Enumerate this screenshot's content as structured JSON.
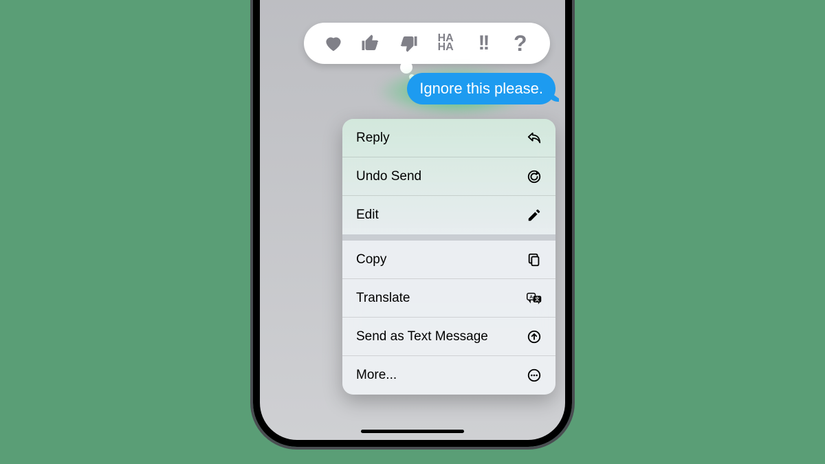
{
  "message": {
    "text": "Ignore this please."
  },
  "tapbacks": {
    "heart": "heart",
    "like": "thumbs-up",
    "dislike": "thumbs-down",
    "haha": "HA HA",
    "emphasis": "!!",
    "question": "?"
  },
  "menu": {
    "reply": "Reply",
    "undo_send": "Undo Send",
    "edit": "Edit",
    "copy": "Copy",
    "translate": "Translate",
    "send_as_text": "Send as Text Message",
    "more": "More..."
  }
}
